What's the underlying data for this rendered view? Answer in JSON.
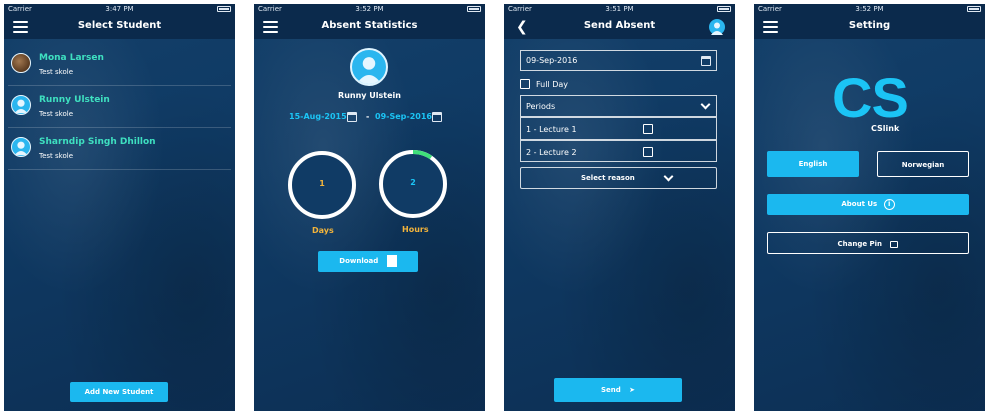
{
  "status": {
    "carrier": "Carrier",
    "times": [
      "3:47 PM",
      "3:52 PM",
      "3:51 PM",
      "3:52 PM"
    ]
  },
  "screen1": {
    "title": "Select Student",
    "students": [
      {
        "name": "Mona Larsen",
        "school": "Test skole"
      },
      {
        "name": "Runny Ulstein",
        "school": "Test skole"
      },
      {
        "name": "Sharndip Singh Dhillon",
        "school": "Test skole"
      }
    ],
    "add_button": "Add New Student"
  },
  "screen2": {
    "title": "Absent Statistics",
    "student_name": "Runny Ulstein",
    "date_from": "15-Aug-2015",
    "separator": "-",
    "date_to": "09-Sep-2016",
    "days_value": "1",
    "days_label": "Days",
    "hours_value": "2",
    "hours_label": "Hours",
    "download_label": "Download"
  },
  "screen3": {
    "title": "Send Absent",
    "date": "09-Sep-2016",
    "full_day": "Full Day",
    "periods": "Periods",
    "lectures": [
      "1 - Lecture 1",
      "2 - Lecture 2"
    ],
    "reason_placeholder": "Select reason",
    "send_label": "Send"
  },
  "screen4": {
    "title": "Setting",
    "logo_text": "CS",
    "logo_sub": "CSlink",
    "english": "English",
    "norwegian": "Norwegian",
    "about": "About Us",
    "change_pin": "Change Pin"
  },
  "colors": {
    "accent": "#1bb8ef",
    "name_green": "#3ee0c0",
    "stat_orange": "#f3b43b",
    "background": "#0f3a64"
  }
}
